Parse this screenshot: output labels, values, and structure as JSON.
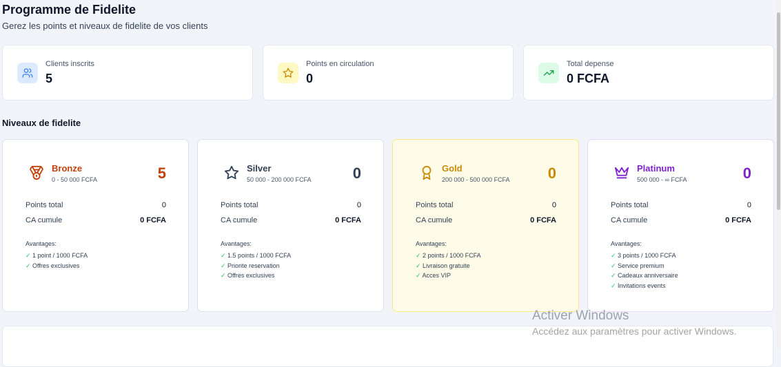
{
  "header": {
    "title": "Programme de Fidelite",
    "subtitle": "Gerez les points et niveaux de fidelite de vos clients"
  },
  "stats": [
    {
      "label": "Clients inscrits",
      "value": "5",
      "icon": "users-icon",
      "color": "#3b82f6",
      "bg": "#dbeafe"
    },
    {
      "label": "Points en circulation",
      "value": "0",
      "icon": "star-icon",
      "color": "#ca8a04",
      "bg": "#fef9c3"
    },
    {
      "label": "Total depense",
      "value": "0 FCFA",
      "icon": "trending-up-icon",
      "color": "#16a34a",
      "bg": "#dcfce7"
    }
  ],
  "tiers_section": {
    "title": "Niveaux de fidelite"
  },
  "tiers": [
    {
      "name": "Bronze",
      "range": "0 - 50 000 FCFA",
      "count": "5",
      "color": "#c2410c",
      "icon": "medal-icon",
      "points_label": "Points total",
      "points_value": "0",
      "ca_label": "CA cumule",
      "ca_value": "0 FCFA",
      "advantages_title": "Avantages:",
      "advantages": [
        "1 point / 1000 FCFA",
        "Offres exclusives"
      ]
    },
    {
      "name": "Silver",
      "range": "50 000 - 200 000 FCFA",
      "count": "0",
      "color": "#334155",
      "icon": "star-outline-icon",
      "points_label": "Points total",
      "points_value": "0",
      "ca_label": "CA cumule",
      "ca_value": "0 FCFA",
      "advantages_title": "Avantages:",
      "advantages": [
        "1.5 points / 1000 FCFA",
        "Priorite reservation",
        "Offres exclusives"
      ]
    },
    {
      "name": "Gold",
      "range": "200 000 - 500 000 FCFA",
      "count": "0",
      "color": "#ca8a04",
      "icon": "award-icon",
      "points_label": "Points total",
      "points_value": "0",
      "ca_label": "CA cumule",
      "ca_value": "0 FCFA",
      "advantages_title": "Avantages:",
      "advantages": [
        "2 points / 1000 FCFA",
        "Livraison gratuite",
        "Acces VIP"
      ]
    },
    {
      "name": "Platinum",
      "range": "500 000 - ∞ FCFA",
      "count": "0",
      "color": "#7e22ce",
      "icon": "crown-icon",
      "points_label": "Points total",
      "points_value": "0",
      "ca_label": "CA cumule",
      "ca_value": "0 FCFA",
      "advantages_title": "Avantages:",
      "advantages": [
        "3 points / 1000 FCFA",
        "Service premium",
        "Cadeaux anniversaire",
        "Invitations events"
      ]
    }
  ],
  "watermark": {
    "title": "Activer Windows",
    "subtitle": "Accédez aux paramètres pour activer Windows."
  }
}
